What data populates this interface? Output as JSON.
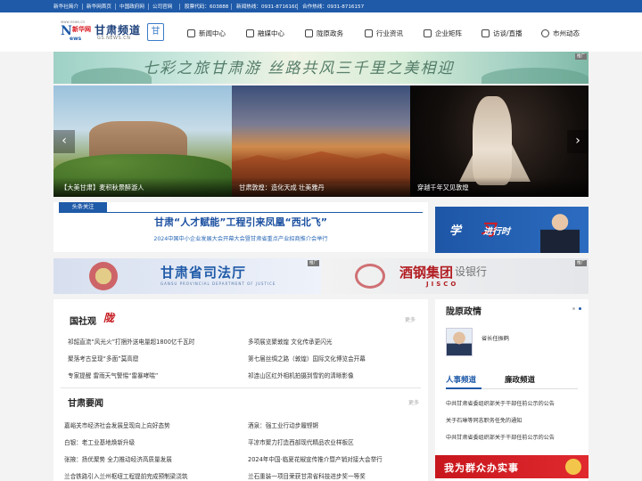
{
  "topbar": {
    "links": [
      "新华社简介",
      "新华网首页",
      "中国政府网",
      "公司官网"
    ],
    "stock_code": "股票代码：603888",
    "news_hotline": "新闻热线：0931-8716160",
    "coop_hotline": "合作热线：0931-8716157"
  },
  "header": {
    "logo_url_text": "www.news.cn",
    "logo_letter": "N",
    "logo_brand": "新华网",
    "logo_ews": "ews",
    "site_name": "甘肃频道",
    "site_url": "GS.NEWS.CN",
    "seal_char": "甘"
  },
  "nav": [
    {
      "label": "新闻中心",
      "icon": "newspaper-icon"
    },
    {
      "label": "融媒中心",
      "icon": "media-icon"
    },
    {
      "label": "陇原政务",
      "icon": "government-icon"
    },
    {
      "label": "行业资讯",
      "icon": "industry-icon"
    },
    {
      "label": "企业矩阵",
      "icon": "enterprise-icon"
    },
    {
      "label": "访谈/直播",
      "icon": "live-icon"
    },
    {
      "label": "市州动态",
      "icon": "location-icon"
    }
  ],
  "banner_top": {
    "calligraphy": "七彩之旅甘肃游 丝路共风三千里之美相迎",
    "ad_label": "推广"
  },
  "slider": {
    "slides": [
      {
        "caption": "【大美甘肃】麦积秋景醉游人"
      },
      {
        "caption": "甘肃敦煌：造化天成 壮美雅丹"
      },
      {
        "caption": "穿越千年又见敦煌"
      }
    ],
    "prev": "‹",
    "next": "›"
  },
  "headline": {
    "tag": "头条关注",
    "title": "甘肃“人才赋能”工程引来凤凰“西北飞”",
    "subtitle": "2024中国中小企业发展大会开幕大会暨甘肃省重点产业招商推介会举行"
  },
  "study_banner": {
    "part1": "学",
    "part2": "习",
    "part3": "进行时"
  },
  "dual_ad": {
    "left_title": "甘肃省司法厅",
    "left_subtitle": "GANSU PROVINCIAL DEPARTMENT OF JUSTICE",
    "right_title": "酒钢集团",
    "right_subtitle": "JISCO",
    "right_bank": "设银行",
    "ad_label": "推广"
  },
  "section1": {
    "title": "国社观",
    "brand": "陇",
    "more": "更多",
    "items": [
      "祁韶直流“风光火”打捆外送电量超1800亿千瓦时",
      "多项展览聚敦煌 文化传承更闪光",
      "聚落考古呈现“多面”莫高窟",
      "第七届丝绸之路（敦煌）国际文化博览会开幕",
      "专家提醒 雷雨天气警惕“雷暴哮喘”",
      "祁连山区红外相机拍摄到雪豹的清晰影像"
    ]
  },
  "section2": {
    "title": "甘肃要闻",
    "more": "更多",
    "items": [
      "嘉峪关市经济社会发展呈现向上向好态势",
      "酒泉：强工业行动步履铿锵",
      "白银：老工业基地焕新升级",
      "平凉市聚力打造西部现代精品农业样板区",
      "张掖：扬优聚势 全力推动经济高质量发展",
      "2024年中国·临夏花椒宣传推介暨产销对接大会举行",
      "兰合铁路引入兰州枢纽工程提前完成预制梁浇筑",
      "兰石重装一项目荣获甘肃省科技进步奖一等奖"
    ]
  },
  "right_panel": {
    "title": "陇原政情",
    "person": "省长任振鹤",
    "tabs": [
      "人事频道",
      "廉政频道"
    ],
    "items": [
      "中共甘肃省委组织部关于干部任前公示的公告",
      "关于石琳等同志职务任免的通知",
      "中共甘肃省委组织部关于干部任前公示的公告"
    ],
    "banner": "我为群众办实事"
  },
  "colors": {
    "brand_blue": "#1f5aa8",
    "accent_red": "#c4161c"
  }
}
